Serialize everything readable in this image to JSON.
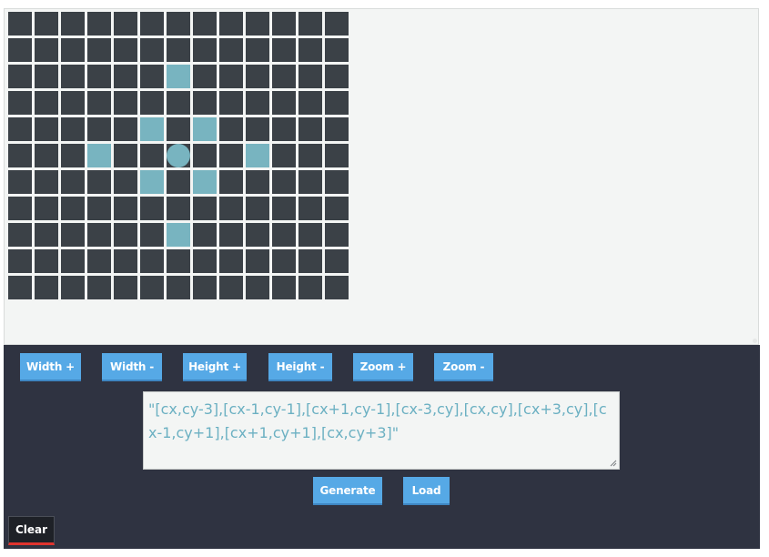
{
  "grid": {
    "columns": 13,
    "rows": 11,
    "active_cells": [
      [
        6,
        2
      ],
      [
        5,
        4
      ],
      [
        7,
        4
      ],
      [
        3,
        5
      ],
      [
        9,
        5
      ],
      [
        5,
        6
      ],
      [
        7,
        6
      ],
      [
        6,
        8
      ]
    ],
    "center_cell": [
      6,
      5
    ],
    "cell_color": "#3b4147",
    "active_color": "#78b4c0"
  },
  "controls": {
    "width_plus": "Width +",
    "width_minus": "Width -",
    "height_plus": "Height +",
    "height_minus": "Height -",
    "zoom_plus": "Zoom +",
    "zoom_minus": "Zoom -"
  },
  "pattern_text": "\"[cx,cy-3],[cx-1,cy-1],[cx+1,cy-1],[cx-3,cy],[cx,cy],[cx+3,cy],[cx-1,cy+1],[cx+1,cy+1],[cx,cy+3]\"",
  "actions": {
    "generate": "Generate",
    "load": "Load",
    "clear": "Clear"
  },
  "colors": {
    "panel_bg": "#2f3341",
    "button_bg": "#56a9e6",
    "clear_underline": "#e0342f"
  }
}
